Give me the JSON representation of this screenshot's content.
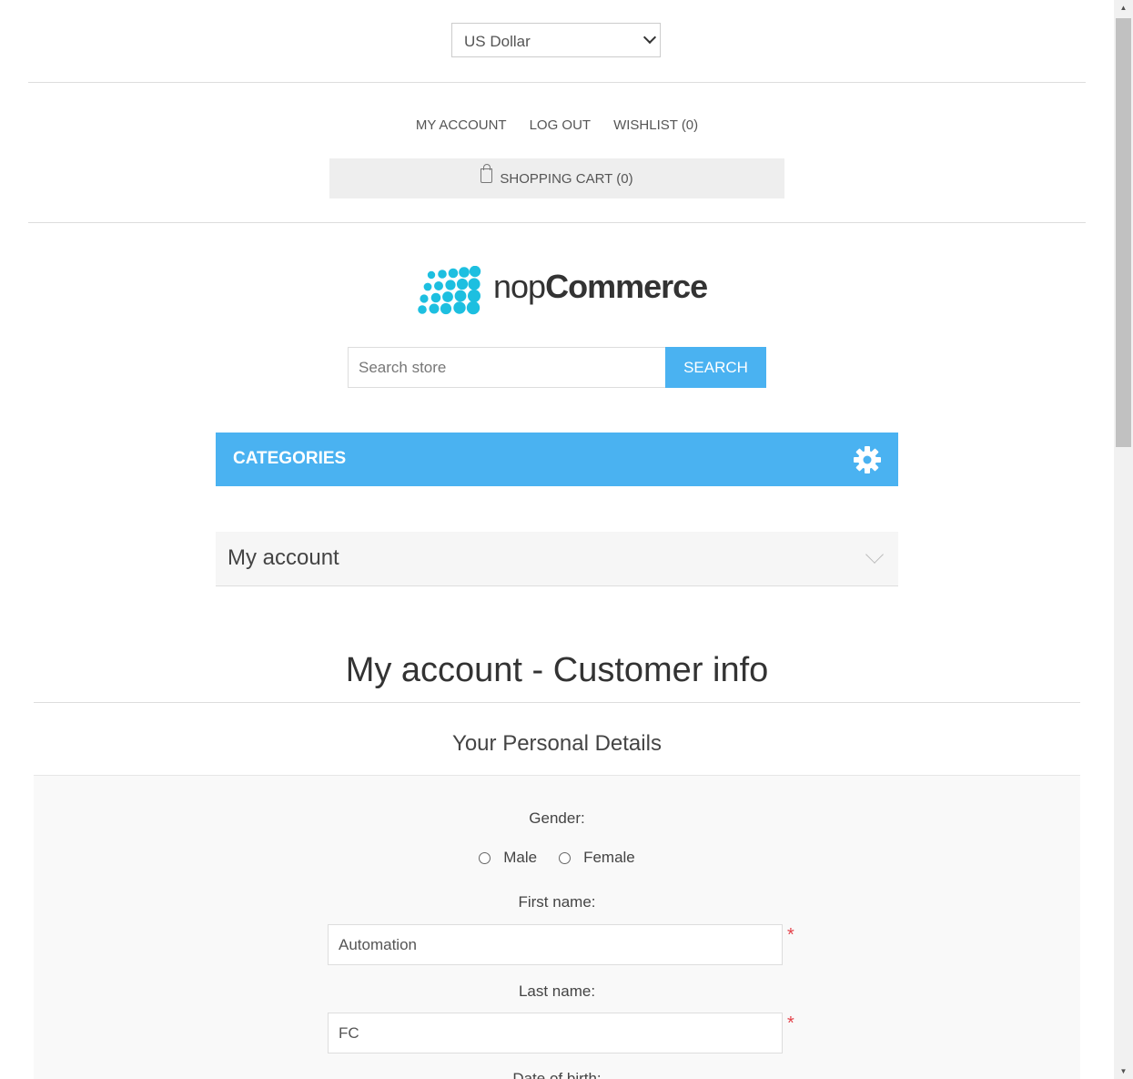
{
  "header": {
    "currency_selected": "US Dollar",
    "links": [
      "My account",
      "Log out",
      "Wishlist (0)"
    ],
    "cart_label": "Shopping cart (0)"
  },
  "logo": {
    "text_light": "nop",
    "text_bold": "Commerce"
  },
  "search": {
    "placeholder": "Search store",
    "button": "Search"
  },
  "categories": {
    "label": "CATEGORIES"
  },
  "account_menu": {
    "label": "My account"
  },
  "page": {
    "title": "My account - Customer info",
    "section_title": "Your Personal Details"
  },
  "form": {
    "gender_label": "Gender:",
    "gender_options": [
      "Male",
      "Female"
    ],
    "first_name_label": "First name:",
    "first_name_value": "Automation",
    "last_name_label": "Last name:",
    "last_name_value": "FC",
    "dob_label": "Date of birth:",
    "required_mark": "*"
  },
  "colors": {
    "accent": "#4ab2f1",
    "required": "#e4434b",
    "logo_dots": "#1dbfe0"
  }
}
